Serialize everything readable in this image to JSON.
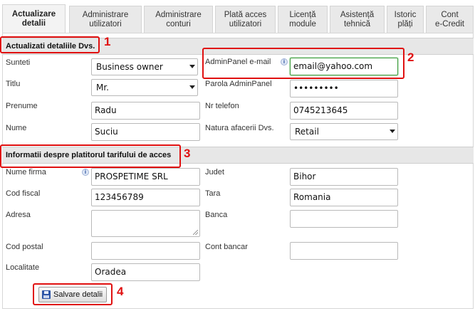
{
  "tabs": [
    {
      "label": "Actualizare\ndetalii",
      "active": true
    },
    {
      "label": "Administrare\nutilizatori",
      "active": false
    },
    {
      "label": "Administrare\nconturi",
      "active": false
    },
    {
      "label": "Plată acces\nutilizatori",
      "active": false
    },
    {
      "label": "Licență\nmodule",
      "active": false
    },
    {
      "label": "Asistență\ntehnică",
      "active": false
    },
    {
      "label": "Istoric\nplăți",
      "active": false
    },
    {
      "label": "Cont\ne-Credit",
      "active": false
    }
  ],
  "section1": {
    "title": "Actualizati detaliile Dvs.",
    "sunteti_label": "Sunteti",
    "sunteti_value": "Business owner",
    "titlu_label": "Titlu",
    "titlu_value": "Mr.",
    "prenume_label": "Prenume",
    "prenume_value": "Radu",
    "nume_label": "Nume",
    "nume_value": "Suciu",
    "email_label": "AdminPanel e-mail",
    "email_value": "email@yahoo.com",
    "parola_label": "Parola AdminPanel",
    "parola_value": "•••••••••",
    "telefon_label": "Nr telefon",
    "telefon_value": "0745213645",
    "natura_label": "Natura afacerii Dvs.",
    "natura_value": "Retail"
  },
  "section2": {
    "title": "Informatii despre platitorul tarifului de acces",
    "firma_label": "Nume firma",
    "firma_value": "PROSPETIME SRL",
    "fiscal_label": "Cod fiscal",
    "fiscal_value": "123456789",
    "adresa_label": "Adresa",
    "adresa_value": "",
    "postal_label": "Cod postal",
    "postal_value": "",
    "localitate_label": "Localitate",
    "localitate_value": "Oradea",
    "judet_label": "Judet",
    "judet_value": "Bihor",
    "tara_label": "Tara",
    "tara_value": "Romania",
    "banca_label": "Banca",
    "banca_value": "",
    "cont_label": "Cont bancar",
    "cont_value": ""
  },
  "save_button": "Salvare detalii",
  "annotations": [
    "1",
    "2",
    "3",
    "4"
  ],
  "colors": {
    "annotation": "#e01010",
    "focus_border": "#3a9a3a"
  },
  "icons": {
    "info": "i",
    "save": "floppy-disk-icon"
  }
}
